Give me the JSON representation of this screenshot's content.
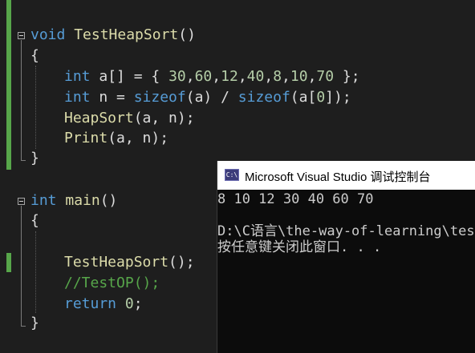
{
  "editor": {
    "lines": [
      {
        "parts": [
          {
            "t": "void",
            "c": "kw"
          },
          {
            "t": " "
          },
          {
            "t": "TestHeapSort",
            "c": "fn"
          },
          {
            "t": "()"
          }
        ]
      },
      {
        "parts": [
          {
            "t": "{"
          }
        ]
      },
      {
        "parts": [
          {
            "t": "int",
            "c": "kw"
          },
          {
            "t": " a[] = { "
          },
          {
            "t": "30",
            "c": "num"
          },
          {
            "t": ","
          },
          {
            "t": "60",
            "c": "num"
          },
          {
            "t": ","
          },
          {
            "t": "12",
            "c": "num"
          },
          {
            "t": ","
          },
          {
            "t": "40",
            "c": "num"
          },
          {
            "t": ","
          },
          {
            "t": "8",
            "c": "num"
          },
          {
            "t": ","
          },
          {
            "t": "10",
            "c": "num"
          },
          {
            "t": ","
          },
          {
            "t": "70",
            "c": "num"
          },
          {
            "t": " };"
          }
        ]
      },
      {
        "parts": [
          {
            "t": "int",
            "c": "kw"
          },
          {
            "t": " n = "
          },
          {
            "t": "sizeof",
            "c": "kw"
          },
          {
            "t": "(a) / "
          },
          {
            "t": "sizeof",
            "c": "kw"
          },
          {
            "t": "(a["
          },
          {
            "t": "0",
            "c": "num"
          },
          {
            "t": "]);"
          }
        ]
      },
      {
        "parts": [
          {
            "t": "HeapSort",
            "c": "fn"
          },
          {
            "t": "(a, n);"
          }
        ]
      },
      {
        "parts": [
          {
            "t": "Print",
            "c": "fn"
          },
          {
            "t": "(a, n);"
          }
        ]
      },
      {
        "parts": [
          {
            "t": "}"
          }
        ]
      },
      {
        "parts": [
          {
            "t": "int",
            "c": "kw"
          },
          {
            "t": " "
          },
          {
            "t": "main",
            "c": "fn"
          },
          {
            "t": "()"
          }
        ]
      },
      {
        "parts": [
          {
            "t": "{"
          }
        ]
      },
      {
        "parts": [
          {
            "t": "TestHeapSort",
            "c": "fn"
          },
          {
            "t": "();"
          }
        ]
      },
      {
        "parts": [
          {
            "t": "//TestOP();",
            "c": "cm"
          }
        ]
      },
      {
        "parts": [
          {
            "t": "return",
            "c": "kw"
          },
          {
            "t": " "
          },
          {
            "t": "0",
            "c": "num"
          },
          {
            "t": ";"
          }
        ]
      },
      {
        "parts": [
          {
            "t": "}"
          }
        ]
      }
    ]
  },
  "console": {
    "title": "Microsoft Visual Studio 调试控制台",
    "icon": "C:\\",
    "output": [
      "8 10 12 30 40 60 70",
      "",
      "D:\\C语言\\the-way-of-learning\\test",
      "按任意键关闭此窗口. . ."
    ]
  }
}
